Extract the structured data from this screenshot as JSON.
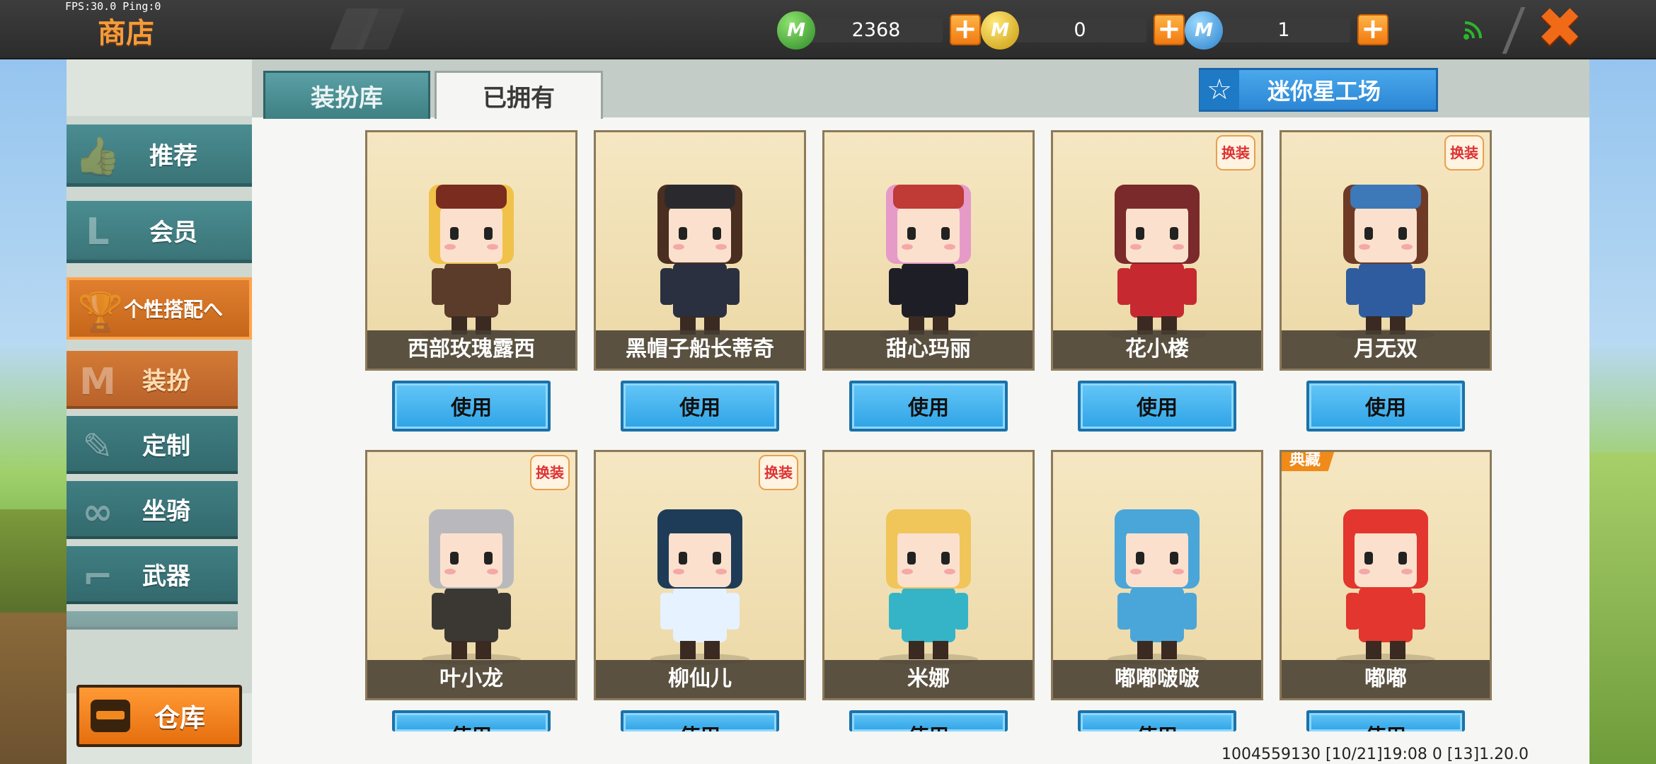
{
  "status": {
    "fps": "FPS:30.0  Ping:0"
  },
  "header": {
    "title": "商店",
    "close_icon": "✖"
  },
  "currencies": [
    {
      "name": "mini-bean",
      "icon": "M",
      "color": "#3fa83a",
      "value": "2368"
    },
    {
      "name": "mini-coin",
      "icon": "M",
      "color": "#e8c21c",
      "value": "0"
    },
    {
      "name": "mini-point",
      "icon": "M",
      "color": "#3aa0e6",
      "value": "1"
    }
  ],
  "sidebar": {
    "items": [
      {
        "label": "推荐",
        "icon": "thumb-up-icon"
      },
      {
        "label": "会员",
        "icon": "vip-icon"
      },
      {
        "label": "个性搭配へ",
        "icon": "trophy-icon"
      },
      {
        "label": "装扮",
        "icon": "shirt-icon"
      },
      {
        "label": "定制",
        "icon": "pencil-icon"
      },
      {
        "label": "坐骑",
        "icon": "mount-icon"
      },
      {
        "label": "武器",
        "icon": "gun-icon"
      }
    ],
    "storage_label": "仓库"
  },
  "tabs": [
    {
      "label": "装扮库"
    },
    {
      "label": "已拥有"
    }
  ],
  "workshop_label": "迷你星工场",
  "characters": [
    {
      "name": "西部玫瑰露西",
      "badge": "",
      "tag": "",
      "hair": "#f1c24a",
      "outfit": "#5b3b2a",
      "hat": "#7a2c1e"
    },
    {
      "name": "黑帽子船长蒂奇",
      "badge": "",
      "tag": "",
      "hair": "#4a2e20",
      "outfit": "#2b3040",
      "hat": "#2a2a2e"
    },
    {
      "name": "甜心玛丽",
      "badge": "",
      "tag": "",
      "hair": "#e59ac8",
      "outfit": "#1e1e26",
      "hat": "#c03a36"
    },
    {
      "name": "花小楼",
      "badge": "换装",
      "tag": "",
      "hair": "#7a2a2a",
      "outfit": "#c62a30",
      "hat": "#7a2a2a"
    },
    {
      "name": "月无双",
      "badge": "换装",
      "tag": "",
      "hair": "#6e3a26",
      "outfit": "#2f5c9e",
      "hat": "#3d78b8"
    },
    {
      "name": "叶小龙",
      "badge": "换装",
      "tag": "",
      "hair": "#b9b9bd",
      "outfit": "#3b3834",
      "hat": "#b9b9bd"
    },
    {
      "name": "柳仙儿",
      "badge": "换装",
      "tag": "",
      "hair": "#1e3c58",
      "outfit": "#e6f2ff",
      "hat": "#1e3c58"
    },
    {
      "name": "米娜",
      "badge": "",
      "tag": "",
      "hair": "#f0c55a",
      "outfit": "#35b4c8",
      "hat": "#f0c55a"
    },
    {
      "name": "嘟嘟啵啵",
      "badge": "",
      "tag": "",
      "hair": "#4aa6d8",
      "outfit": "#4aa6d8",
      "hat": "#4aa6d8"
    },
    {
      "name": "嘟嘟",
      "badge": "",
      "tag": "典藏",
      "hair": "#e2362e",
      "outfit": "#e2362e",
      "hat": "#e2362e"
    }
  ],
  "use_label": "使用",
  "footer": {
    "info": "1004559130    [10/21]19:08 0    [13]1.20.0"
  }
}
